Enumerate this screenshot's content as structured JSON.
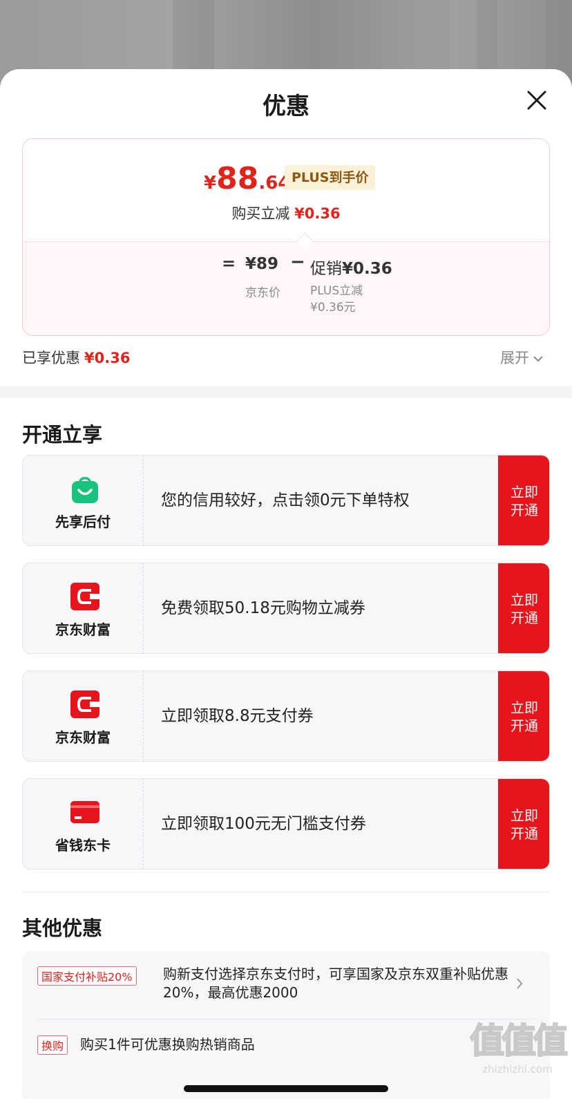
{
  "sheet": {
    "title": "优惠"
  },
  "price": {
    "currency": "¥",
    "integer": "88",
    "decimal": ".64",
    "plus_tag": "PLUS到手价",
    "instant_label": "购买立减",
    "instant_value": "¥0.36",
    "equals": "=",
    "base_price": "¥89",
    "minus": "−",
    "promo_label": "促销",
    "promo_value": "¥0.36",
    "base_caption": "京东价",
    "promo_caption_1": "PLUS立减",
    "promo_caption_2": "¥0.36元"
  },
  "summary": {
    "enjoyed_label": "已享优惠",
    "enjoyed_value": "¥0.36",
    "expand_label": "展开"
  },
  "open_section": {
    "title": "开通立享",
    "offers": [
      {
        "name": "先享后付",
        "desc": "您的信用较好，点击领0元下单特权",
        "btn1": "立即",
        "btn2": "开通",
        "icon": "shopping-bag-icon",
        "color": "#19c37d"
      },
      {
        "name": "京东财富",
        "desc": "免费领取50.18元购物立减券",
        "btn1": "立即",
        "btn2": "开通",
        "icon": "wallet-icon",
        "color": "#e8141c"
      },
      {
        "name": "京东财富",
        "desc": "立即领取8.8元支付券",
        "btn1": "立即",
        "btn2": "开通",
        "icon": "wallet-icon",
        "color": "#e8141c"
      },
      {
        "name": "省钱东卡",
        "desc": "立即领取100元无门槛支付券",
        "btn1": "立即",
        "btn2": "开通",
        "icon": "card-icon",
        "color": "#e8141c"
      }
    ]
  },
  "other_section": {
    "title": "其他优惠",
    "row1_tag": "国家支付补贴20%",
    "row1_text": "购新支付选择京东支付时，可享国家及京东双重补贴优惠20%，最高优惠2000",
    "row2_tag": "换购",
    "row2_text": "购买1件可优惠换购热销商品"
  },
  "watermark": {
    "glyph": "值值值",
    "url": "zhizhizhi.com"
  }
}
